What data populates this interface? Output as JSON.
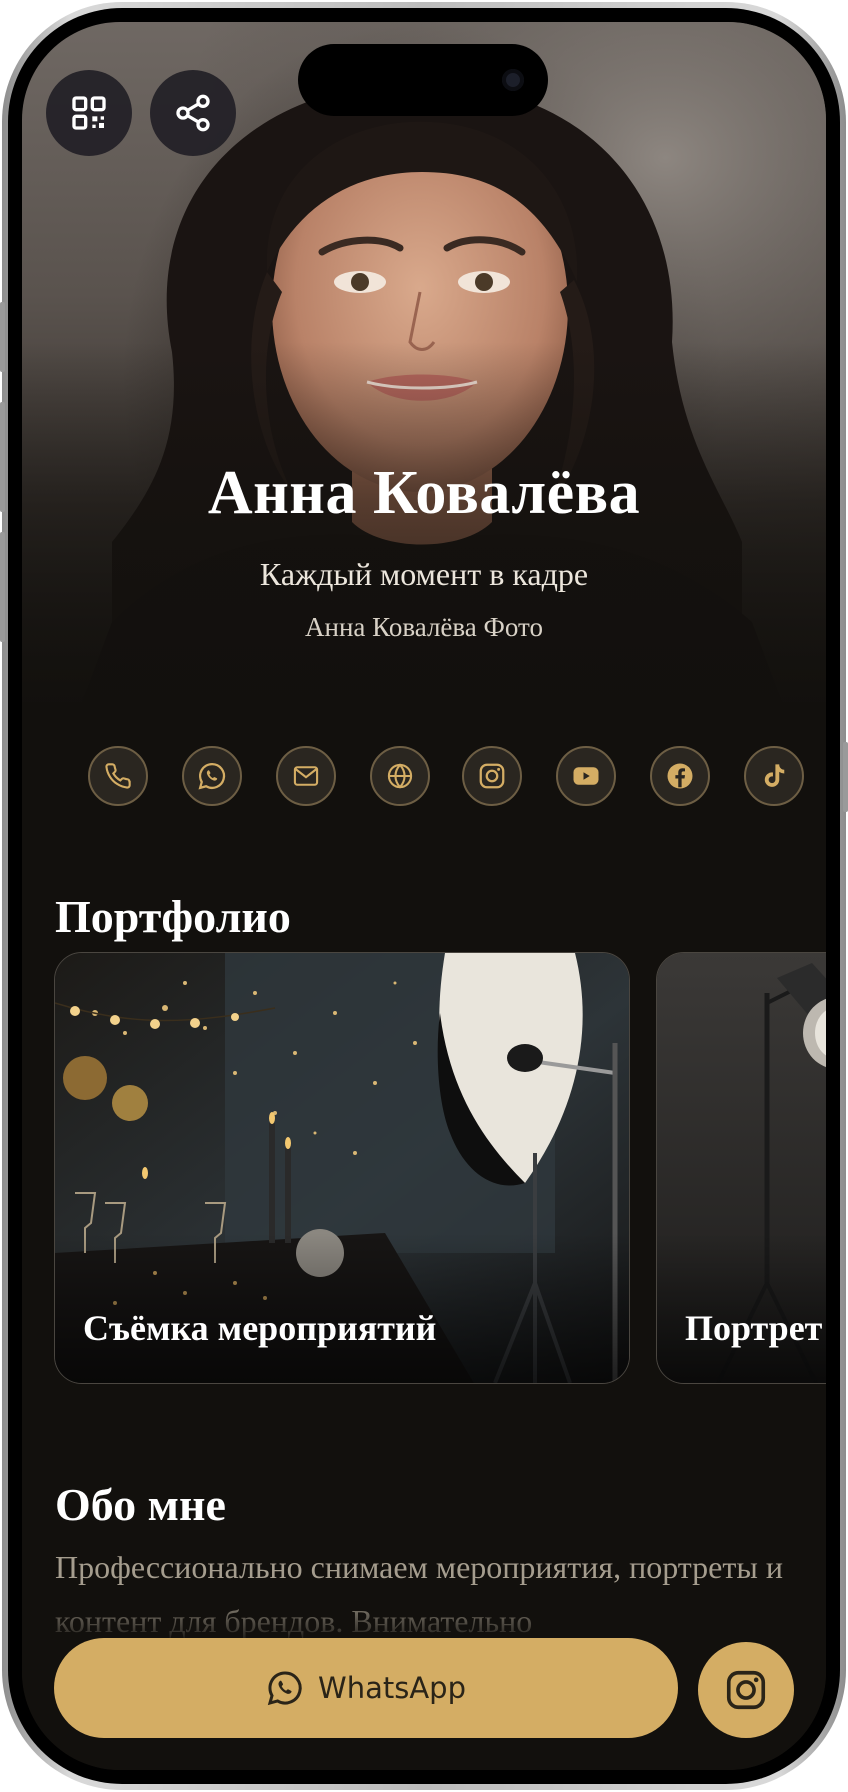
{
  "profile": {
    "name": "Анна Ковалёва",
    "tagline": "Каждый момент в кадре",
    "company": "Анна Ковалёва Фото"
  },
  "top_actions": [
    {
      "icon": "qr-code-icon"
    },
    {
      "icon": "share-icon"
    }
  ],
  "contacts": [
    {
      "icon": "phone-icon"
    },
    {
      "icon": "whatsapp-icon"
    },
    {
      "icon": "mail-icon"
    },
    {
      "icon": "globe-icon"
    },
    {
      "icon": "instagram-icon"
    },
    {
      "icon": "youtube-icon"
    },
    {
      "icon": "facebook-icon"
    },
    {
      "icon": "tiktok-icon"
    }
  ],
  "portfolio": {
    "title": "Портфолио",
    "items": [
      {
        "label": "Съёмка мероприятий"
      },
      {
        "label": "Портрет"
      }
    ]
  },
  "about": {
    "title": "Обо мне",
    "text": "Профессионально снимаем мероприятия, портреты и контент для брендов. Внимательно"
  },
  "cta": {
    "whatsapp_label": "WhatsApp",
    "instagram_icon": "instagram-icon"
  },
  "colors": {
    "accent": "#d4ad64",
    "background": "#12100d",
    "muted_text": "#a59d8e"
  }
}
